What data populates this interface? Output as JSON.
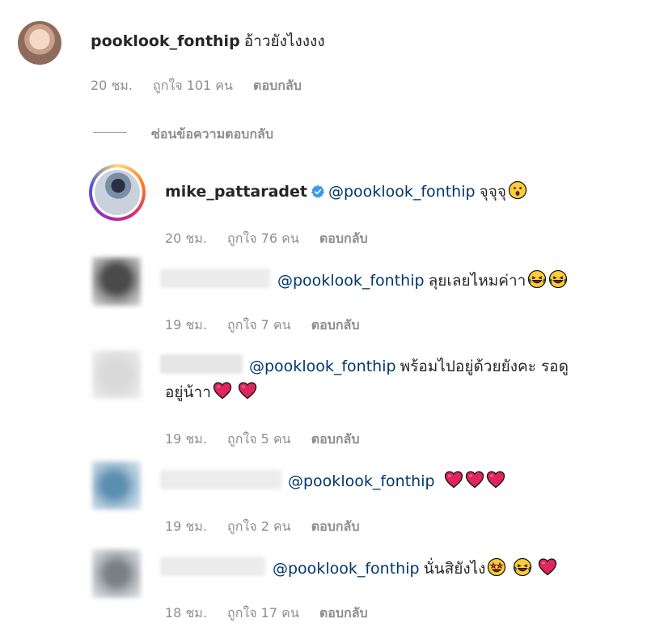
{
  "comment": {
    "username": "pooklook_fonthip",
    "text": "อ้าวยังไงงงง",
    "time": "20 ชม.",
    "likes": "ถูกใจ 101 คน",
    "reply": "ตอบกลับ"
  },
  "hide_replies": "ซ่อนข้อความตอบกลับ",
  "replies": [
    {
      "username": "mike_pattaradet",
      "mention": "@pooklook_fonthip",
      "text": "จุจุจุ",
      "time": "20 ชม.",
      "likes": "ถูกใจ 76 คน",
      "reply": "ตอบกลับ"
    },
    {
      "mention": "@pooklook_fonthip",
      "text": "ลุยเลยไหมค่าา",
      "time": "19 ชม.",
      "likes": "ถูกใจ 7 คน",
      "reply": "ตอบกลับ"
    },
    {
      "mention": "@pooklook_fonthip",
      "text": "พร้อมไปอยู่ด้วยยังคะ รอดู",
      "text_line2": "อยู่น้าา",
      "time": "19 ชม.",
      "likes": "ถูกใจ 5 คน",
      "reply": "ตอบกลับ"
    },
    {
      "mention": "@pooklook_fonthip",
      "time": "19 ชม.",
      "likes": "ถูกใจ 2 คน",
      "reply": "ตอบกลับ"
    },
    {
      "mention": "@pooklook_fonthip",
      "text": "นั่นสิยังไง",
      "time": "18 ชม.",
      "likes": "ถูกใจ 17 คน",
      "reply": "ตอบกลับ"
    }
  ],
  "colors": {
    "mention": "#00376b",
    "meta": "#8e8e8e",
    "verified": "#3897f0",
    "heart": "#e0245e"
  }
}
